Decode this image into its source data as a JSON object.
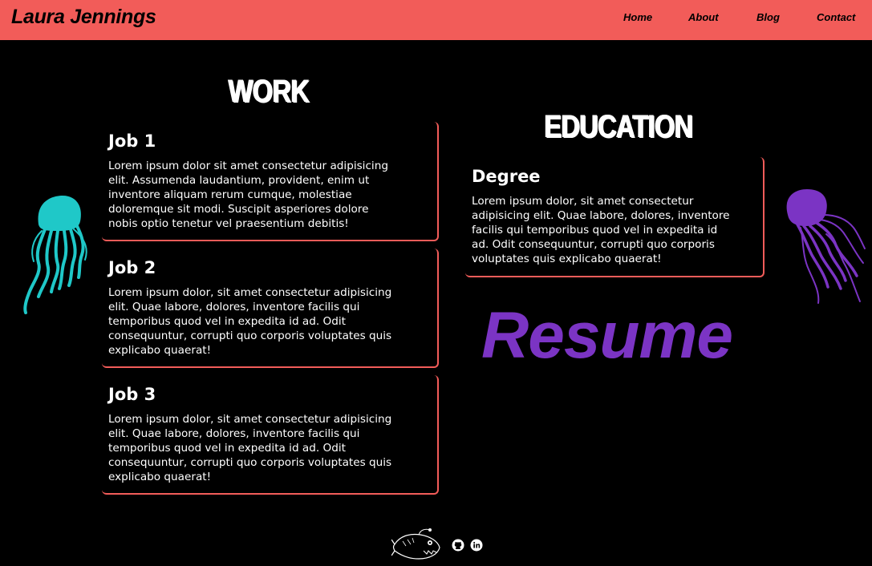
{
  "header": {
    "brand": "Laura Jennings",
    "nav": [
      "Home",
      "About",
      "Blog",
      "Contact"
    ]
  },
  "work": {
    "title": "WORK",
    "jobs": [
      {
        "title": "Job 1",
        "lines": [
          "Lorem ipsum dolor sit amet consectetur adipisicing",
          "elit. Assumenda laudantium, provident, enim ut",
          "inventore aliquam rerum cumque, molestiae",
          "doloremque sit modi. Suscipit asperiores dolore",
          "nobis optio tenetur vel praesentium debitis!"
        ]
      },
      {
        "title": "Job 2",
        "lines": [
          "Lorem ipsum dolor, sit amet consectetur adipisicing",
          "elit. Quae labore, dolores, inventore facilis qui",
          "temporibus quod vel in expedita id ad. Odit",
          "consequuntur, corrupti quo corporis voluptates quis",
          "explicabo quaerat!"
        ]
      },
      {
        "title": "Job 3",
        "lines": [
          "Lorem ipsum dolor, sit amet consectetur adipisicing",
          "elit. Quae labore, dolores, inventore facilis qui",
          "temporibus quod vel in expedita id ad. Odit",
          "consequuntur, corrupti quo corporis voluptates quis",
          "explicabo quaerat!"
        ]
      }
    ]
  },
  "education": {
    "title": "EDUCATION",
    "entries": [
      {
        "title": "Degree",
        "lines": [
          "Lorem ipsum dolor, sit amet consectetur",
          "adipisicing elit. Quae labore, dolores, inventore",
          "facilis qui temporibus quod vel in expedita id",
          "ad. Odit consequuntur, corrupti quo corporis",
          "voluptates quis explicabo quaerat!"
        ]
      }
    ]
  },
  "resume_label": "Resume",
  "icons": {
    "left_jelly": "jellyfish-icon",
    "right_jelly": "jellyfish-icon",
    "footer_fish": "anglerfish-icon",
    "github": "github-icon",
    "linkedin": "linkedin-icon"
  },
  "colors": {
    "accent": "#f25c59",
    "purple": "#7b34c4",
    "teal": "#1fc8c8",
    "background": "#000000"
  }
}
